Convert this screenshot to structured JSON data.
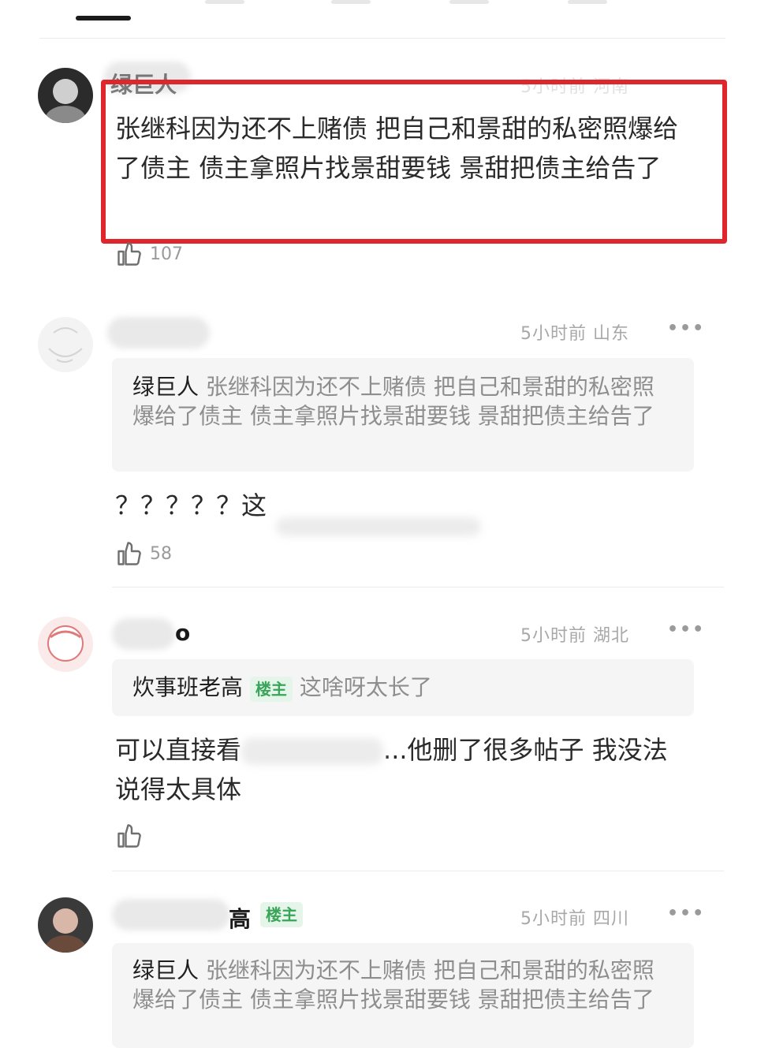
{
  "comments": [
    {
      "username": "绿巨人",
      "time": "5小时前",
      "location": "河南",
      "text": "张继科因为还不上赌债 把自己和景甜的私密照爆给了债主 债主拿照片找景甜要钱 景甜把债主给告了",
      "likes": "107"
    },
    {
      "username": "",
      "time": "5小时前",
      "location": "山东",
      "quote_author": "绿巨人",
      "quote_text": "张继科因为还不上赌债 把自己和景甜的私密照爆给了债主 债主拿照片找景甜要钱 景甜把债主给告了",
      "text": "？？？？？这",
      "likes": "58"
    },
    {
      "username_tail": "o",
      "time": "5小时前",
      "location": "湖北",
      "quote_author": "炊事班老高",
      "quote_badge": "楼主",
      "quote_text": "这啥呀太长了",
      "text_before": "可以直接看",
      "text_after": "...他删了很多帖子 我没法说得太具体",
      "likes": ""
    },
    {
      "username_tail": "高",
      "badge": "楼主",
      "time": "5小时前",
      "location": "四川",
      "quote_author": "绿巨人",
      "quote_text": "张继科因为还不上赌债 把自己和景甜的私密照爆给了债主 债主拿照片找景甜要钱 景甜把债主给告了"
    }
  ],
  "more_label": "•••",
  "colors": {
    "highlight": "#e0262d",
    "op_badge": "#3aa55a"
  }
}
